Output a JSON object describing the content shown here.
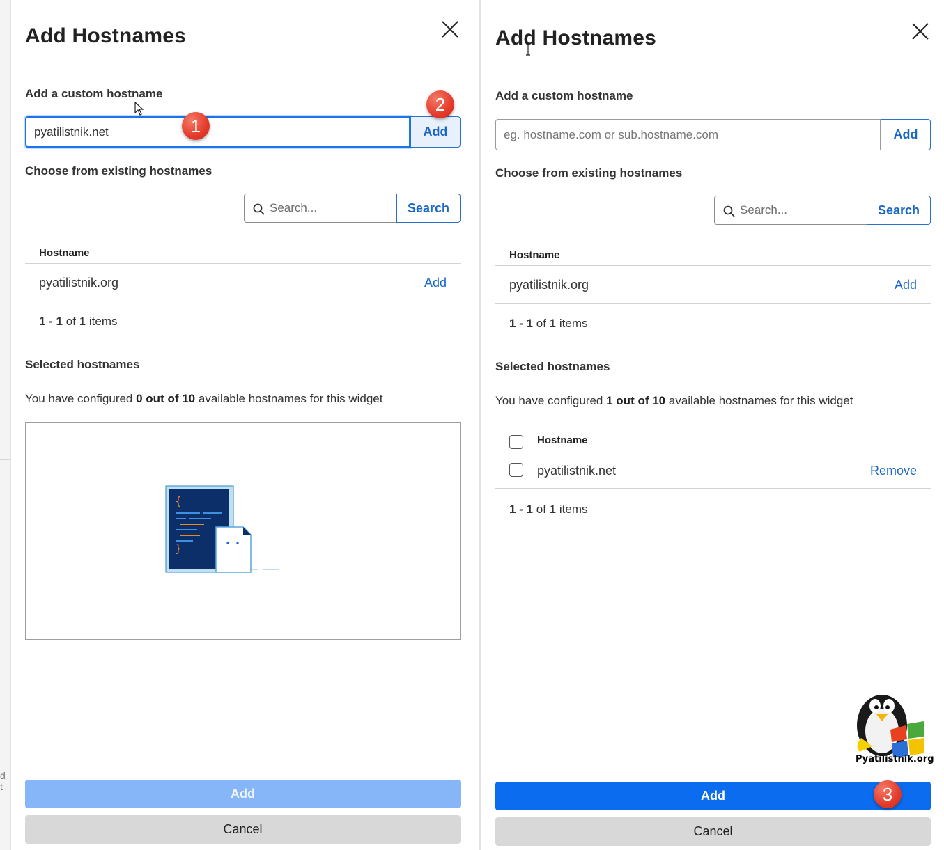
{
  "background": {
    "ghost_text": "d t"
  },
  "left_panel": {
    "title": "Add Hostnames",
    "custom_label": "Add a custom hostname",
    "custom_input_value": "pyatilistnik.net",
    "custom_add_label": "Add",
    "existing_label": "Choose from existing hostnames",
    "search_placeholder": "Search...",
    "search_button": "Search",
    "table": {
      "column": "Hostname",
      "rows": [
        {
          "hostname": "pyatilistnik.org",
          "action": "Add"
        }
      ]
    },
    "pager": {
      "range": "1 - 1",
      "of": "of",
      "total": "1",
      "unit": "items"
    },
    "selected_label": "Selected hostnames",
    "configured": {
      "prefix": "You have configured",
      "count": "0 out of 10",
      "suffix": "available hostnames for this widget"
    },
    "footer_add": "Add",
    "footer_cancel": "Cancel",
    "badges": {
      "input": "1",
      "add": "2"
    }
  },
  "right_panel": {
    "title": "Add Hostnames",
    "custom_label": "Add a custom hostname",
    "custom_input_placeholder": "eg. hostname.com or sub.hostname.com",
    "custom_add_label": "Add",
    "existing_label": "Choose from existing hostnames",
    "search_placeholder": "Search...",
    "search_button": "Search",
    "table": {
      "column": "Hostname",
      "rows": [
        {
          "hostname": "pyatilistnik.org",
          "action": "Add"
        }
      ]
    },
    "pager": {
      "range": "1 - 1",
      "of": "of",
      "total": "1",
      "unit": "items"
    },
    "selected_label": "Selected hostnames",
    "configured": {
      "prefix": "You have configured",
      "count": "1 out of 10",
      "suffix": "available hostnames for this widget"
    },
    "selected_table": {
      "column": "Hostname",
      "rows": [
        {
          "hostname": "pyatilistnik.net",
          "action": "Remove"
        }
      ]
    },
    "selected_pager": {
      "range": "1 - 1",
      "of": "of",
      "total": "1",
      "unit": "items"
    },
    "footer_add": "Add",
    "footer_cancel": "Cancel",
    "badges": {
      "add": "3"
    }
  },
  "watermark": {
    "text": "Pyatilistnik.org"
  },
  "colors": {
    "accent": "#1a67c8",
    "primary_button": "#0b6cf0",
    "primary_button_disabled": "#86b6f8",
    "secondary_button": "#d8d8d8",
    "badge": "#e53a2a"
  }
}
